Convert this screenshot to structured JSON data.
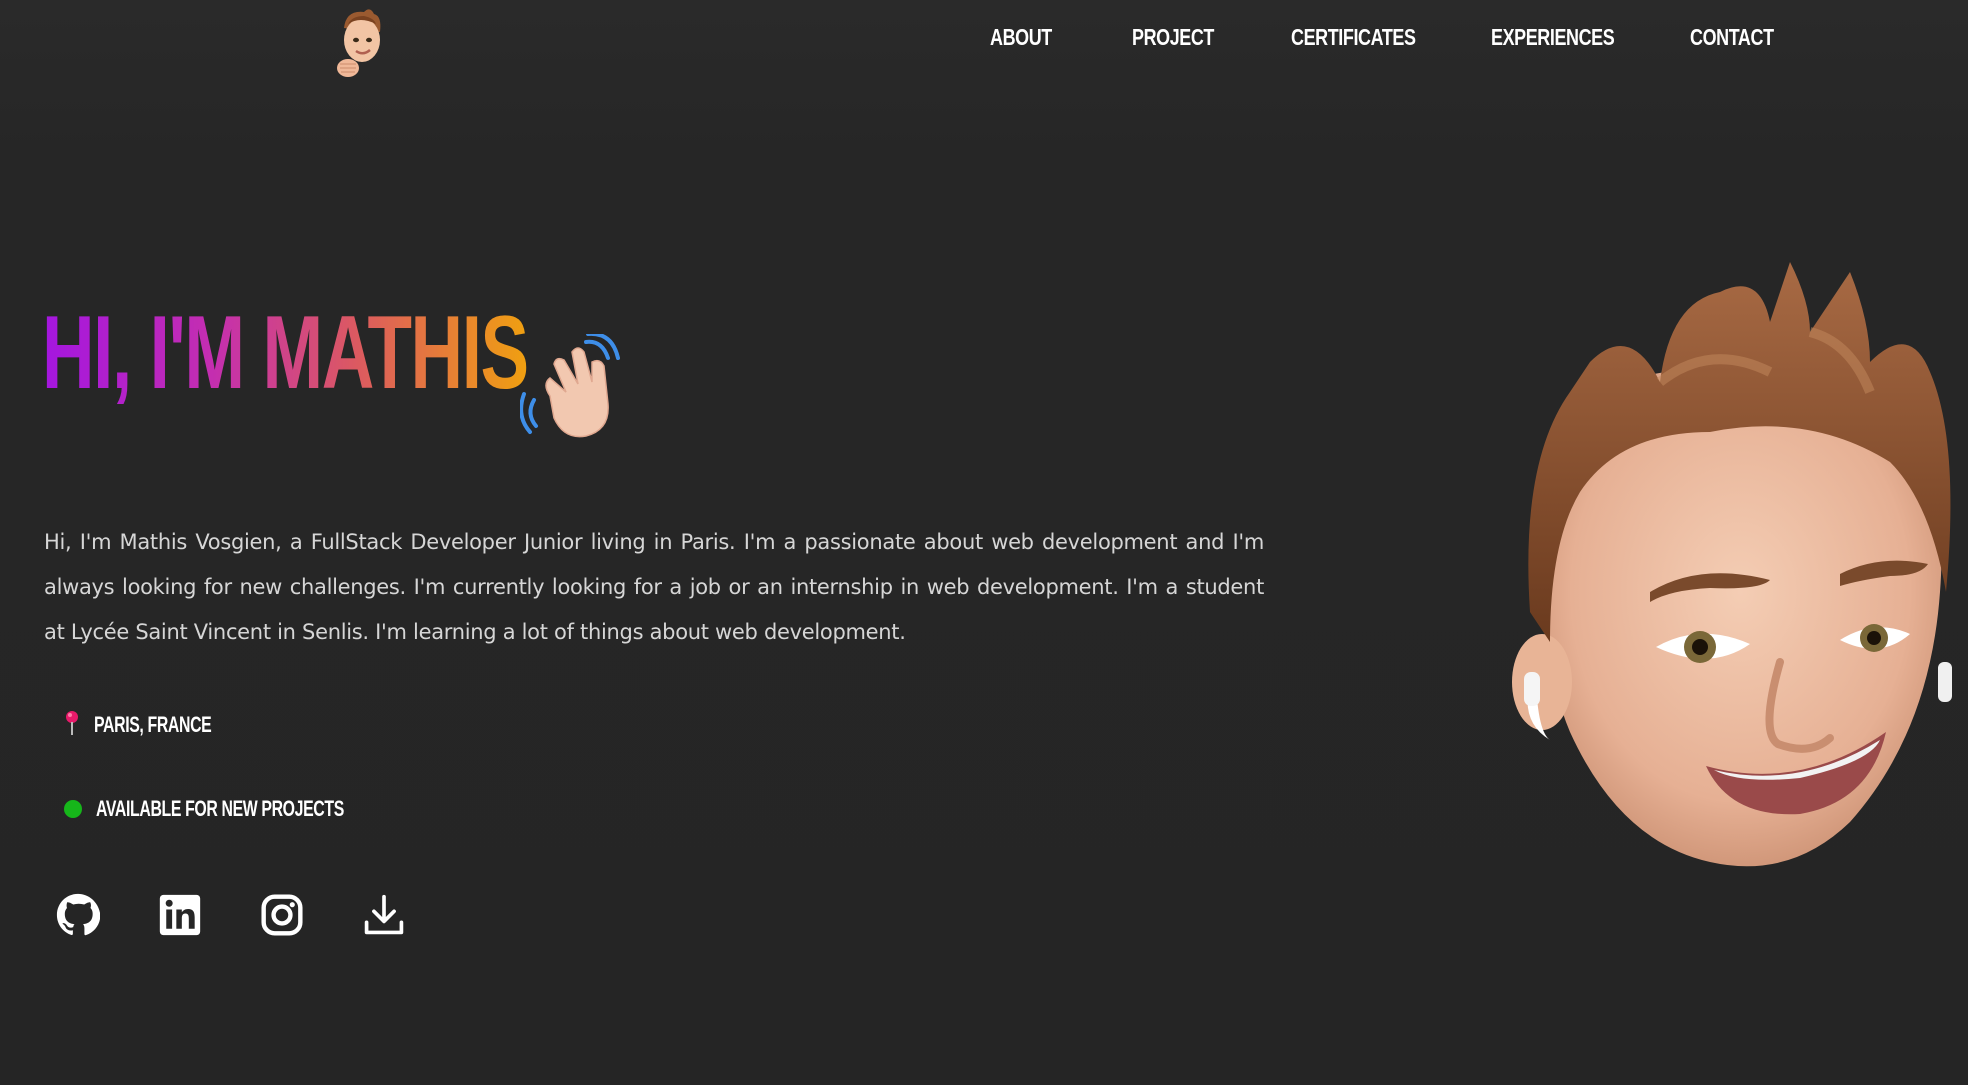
{
  "header": {
    "logo_icon": "memoji-avatar-logo",
    "nav": [
      {
        "label": "ABOUT"
      },
      {
        "label": "PROJECT"
      },
      {
        "label": "CERTIFICATES"
      },
      {
        "label": "EXPERIENCES"
      },
      {
        "label": "CONTACT"
      }
    ]
  },
  "hero": {
    "title": "HI, I'M MATHIS",
    "wave_icon": "waving-hand-icon",
    "gradient": [
      "#a416e0",
      "#c42eb0",
      "#dc5a60",
      "#f0a010"
    ],
    "bio": "Hi, I'm Mathis Vosgien, a FullStack Developer Junior living in Paris. I'm a passionate about web development and I'm always looking for new challenges. I'm currently looking for a job or an internship in web development. I'm a student at Lycée Saint Vincent in Senlis. I'm learning a lot of things about web development.",
    "location": {
      "icon": "map-pin-icon",
      "label": "PARIS, FRANCE"
    },
    "availability": {
      "icon": "green-dot-icon",
      "color": "#16b61a",
      "label": "AVAILABLE FOR NEW PROJECTS"
    },
    "socials": [
      {
        "icon": "github-icon"
      },
      {
        "icon": "linkedin-icon"
      },
      {
        "icon": "instagram-icon"
      },
      {
        "icon": "download-icon"
      }
    ],
    "avatar_icon": "memoji-avatar-large"
  },
  "colors": {
    "background": "#262626",
    "text": "#d6d6d6",
    "nav_text": "#ffffff"
  }
}
